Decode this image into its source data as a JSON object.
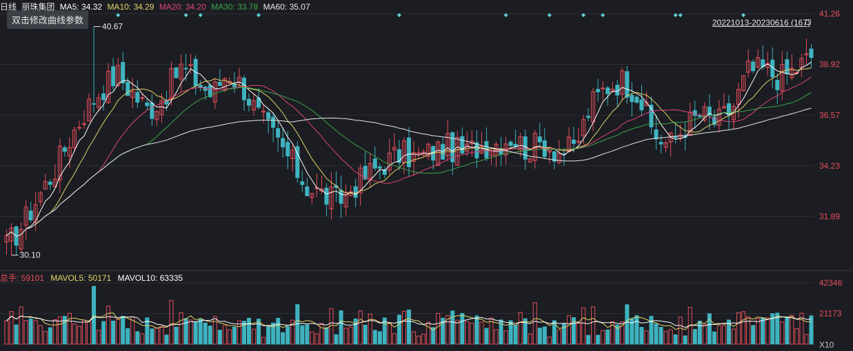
{
  "header": {
    "kline_label": "日线",
    "stock_name": "丽珠集团",
    "ma5_label": "MA5: 34.32",
    "ma10_label": "MA10: 34.29",
    "ma20_label": "MA20: 34.20",
    "ma30_label": "MA30: 33.78",
    "ma60_label": "MA60: 35.07"
  },
  "tooltip": "双击修改曲线参数",
  "range_label": "20221013-20230616 (167)",
  "volume_legend": {
    "total_label": "总手: 59101",
    "mavol5_label": "MAVOL5: 50171",
    "mavol10_label": "MAVOL10: 63335"
  },
  "colors": {
    "bg": "#1b1d22",
    "up": "#e84f5c",
    "down": "#3fb3c0",
    "ma5": "#ffffff",
    "ma10": "#e6d66a",
    "ma20": "#e2447a",
    "ma30": "#3ca64a",
    "ma60": "#e8e8e8",
    "axis_text": "#e84f5c",
    "grid": "#2c2f36"
  },
  "chart_data": [
    {
      "type": "candlestick",
      "title": "丽珠集团 日线",
      "period": "20221013-20230616",
      "bars_count": 167,
      "ylim": [
        29.55,
        41.26
      ],
      "y_ticks": [
        "41.26",
        "38.92",
        "36.57",
        "34.23",
        "31.89"
      ],
      "annotations": {
        "high": "40.67",
        "low": "30.10"
      },
      "price_anchors": [
        30.5,
        31.5,
        32.8,
        34.0,
        35.5,
        36.8,
        37.8,
        38.5,
        37.6,
        36.8,
        37.5,
        38.8,
        38.2,
        37.5,
        38.6,
        37.9,
        36.5,
        35.5,
        34.5,
        33.3,
        32.9,
        32.6,
        33.3,
        33.9,
        34.4,
        34.8,
        34.6,
        34.9,
        35.1,
        34.8,
        35.2,
        35.3,
        35.6,
        35.0,
        35.3,
        34.9,
        35.0,
        37.0,
        37.9,
        38.2,
        37.6,
        35.7,
        35.2,
        36.1,
        36.6,
        36.2,
        36.9,
        38.6,
        38.7,
        38.3,
        38.7,
        39.3
      ],
      "ma5_last": 34.32,
      "ma10_last": 34.29,
      "ma20_last": 34.2,
      "ma30_last": 33.78,
      "ma60_last": 35.07
    },
    {
      "type": "bar",
      "title": "总手",
      "y_ticks": [
        "42346",
        "21173",
        "X10"
      ],
      "ylim": [
        0,
        42346
      ],
      "last_volume": 59101,
      "mavol5": 50171,
      "mavol10": 63335
    }
  ]
}
